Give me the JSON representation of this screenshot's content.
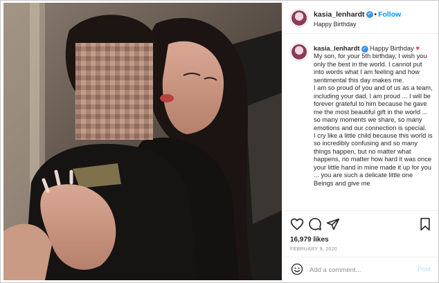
{
  "post": {
    "username": "kasia_lenhardt",
    "follow_label": "Follow",
    "location": "Happy Birthday",
    "caption_lead": "Happy Birthday",
    "caption_paragraphs": [
      "My son, for your 5th birthday, I wish you only the best in the world. I cannot put into words what I am feeling and how sentimental this day makes me.",
      "I am so proud of you and of us as a team, including your dad, I am proud ... I will be forever grateful to him because he gave me the most beautiful gift in the world ... so many moments we share, so many emotions and our connection is special.",
      "I cry like a little child because this world is so incredibly confusing and so many things happen, but no matter what happens, no matter how hard it was once your little hand in mine made it up for you ... you are such a delicate little one Beings and give me"
    ],
    "likes": "16,979 likes",
    "date": "FEBRUARY 9, 2020"
  },
  "comment": {
    "placeholder": "Add a comment...",
    "post_label": "Post"
  },
  "colors": {
    "accent": "#0095f6",
    "heart": "#ed4956",
    "verified": "#3897f0"
  },
  "icons": [
    "heart-icon",
    "comment-icon",
    "share-icon",
    "bookmark-icon",
    "emoji-icon",
    "verified-icon",
    "more-icon"
  ]
}
